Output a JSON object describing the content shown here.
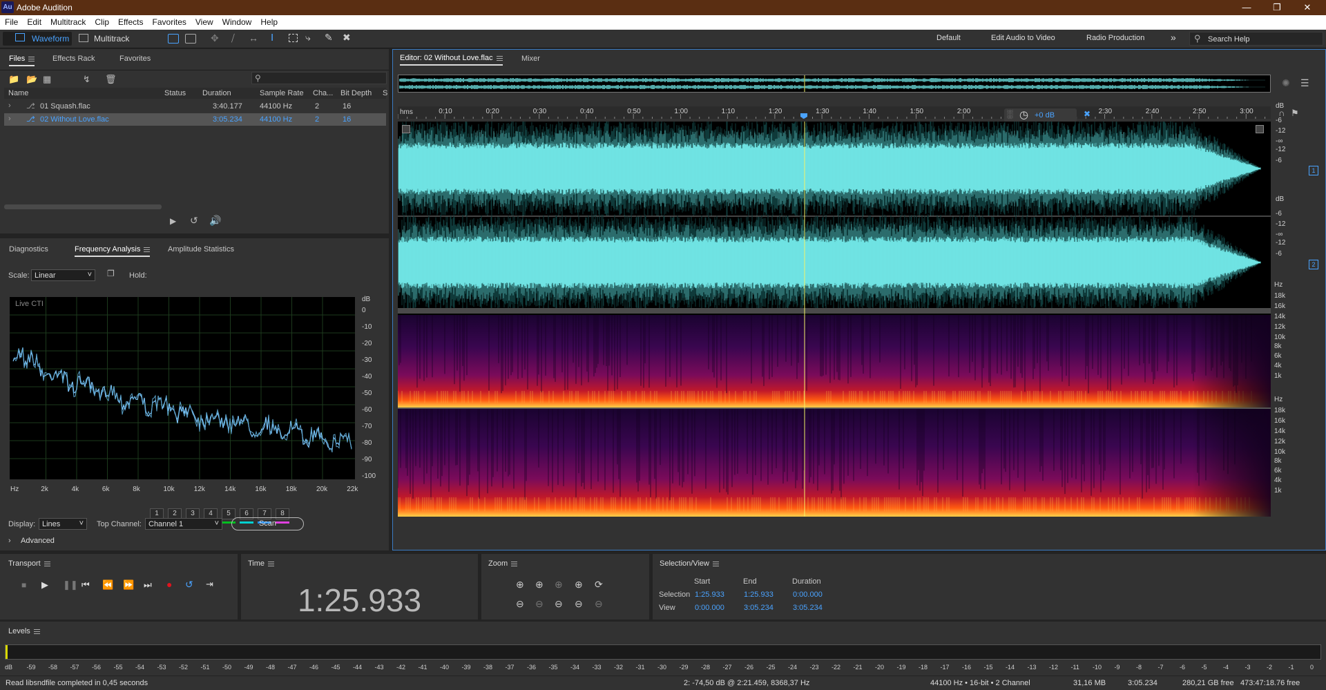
{
  "app": {
    "title": "Adobe Audition",
    "logo": "Au"
  },
  "menu": [
    "File",
    "Edit",
    "Multitrack",
    "Clip",
    "Effects",
    "Favorites",
    "View",
    "Window",
    "Help"
  ],
  "toolbar": {
    "waveform": "Waveform",
    "multitrack": "Multitrack",
    "workspaces": [
      "Default",
      "Edit Audio to Video",
      "Radio Production"
    ],
    "search_placeholder": "Search Help"
  },
  "files_panel": {
    "tabs": [
      "Files",
      "Effects Rack",
      "Favorites"
    ],
    "columns": [
      "Name",
      "Status",
      "Duration",
      "Sample Rate",
      "Cha...",
      "Bit Depth",
      "S"
    ],
    "rows": [
      {
        "name": "01 Squash.flac",
        "status": "",
        "duration": "3:40.177",
        "rate": "44100 Hz",
        "ch": "2",
        "bits": "16"
      },
      {
        "name": "02 Without Love.flac",
        "status": "",
        "duration": "3:05.234",
        "rate": "44100 Hz",
        "ch": "2",
        "bits": "16"
      }
    ]
  },
  "analysis": {
    "tabs": [
      "Diagnostics",
      "Frequency Analysis",
      "Amplitude Statistics"
    ],
    "scale_label": "Scale:",
    "scale_value": "Linear",
    "hold_label": "Hold:",
    "hold": [
      "1",
      "2",
      "3",
      "4",
      "5",
      "6",
      "7",
      "8"
    ],
    "hold_colors": [
      "#e0141e",
      "#ff8c00",
      "#f0e000",
      "#8ce000",
      "#00c020",
      "#00d0d0",
      "#1e90ff",
      "#e040e0"
    ],
    "live": "Live CTI",
    "db_unit": "dB",
    "db_ticks": [
      "0",
      "-10",
      "-20",
      "-30",
      "-40",
      "-50",
      "-60",
      "-70",
      "-80",
      "-90",
      "-100"
    ],
    "hz_ticks": [
      "Hz",
      "2k",
      "4k",
      "6k",
      "8k",
      "10k",
      "12k",
      "14k",
      "16k",
      "18k",
      "20k",
      "22k"
    ],
    "display_label": "Display:",
    "display_value": "Lines",
    "top_channel_label": "Top Channel:",
    "top_channel_value": "Channel 1",
    "scan": "Scan",
    "advanced": "Advanced"
  },
  "editor": {
    "tab": "Editor: 02 Without Love.flac",
    "mixer": "Mixer",
    "time_unit": "hms",
    "time_ticks": [
      "0:10",
      "0:20",
      "0:30",
      "0:40",
      "0:50",
      "1:00",
      "1:10",
      "1:20",
      "1:30",
      "1:40",
      "1:50",
      "2:00",
      "2:30",
      "2:40",
      "2:50",
      "3:00"
    ],
    "gain": "+0 dB",
    "db_ticks_ch": [
      "dB",
      "-6",
      "-12",
      "-∞",
      "-12",
      "-6"
    ],
    "ch_labels": [
      "1",
      "2"
    ],
    "hz_ticks_spec": [
      "Hz",
      "18k",
      "16k",
      "14k",
      "12k",
      "10k",
      "8k",
      "6k",
      "4k",
      "1k"
    ],
    "playhead_fraction": 0.4663
  },
  "transport": {
    "title": "Transport"
  },
  "time": {
    "title": "Time",
    "value": "1:25.933"
  },
  "zoom": {
    "title": "Zoom"
  },
  "selection": {
    "title": "Selection/View",
    "cols": [
      "Start",
      "End",
      "Duration"
    ],
    "selection_label": "Selection",
    "selection": [
      "1:25.933",
      "1:25.933",
      "0:00.000"
    ],
    "view_label": "View",
    "view": [
      "0:00.000",
      "3:05.234",
      "3:05.234"
    ]
  },
  "levels": {
    "title": "Levels",
    "ticks": [
      "dB",
      "-59",
      "-58",
      "-57",
      "-56",
      "-55",
      "-54",
      "-53",
      "-52",
      "-51",
      "-50",
      "-49",
      "-48",
      "-47",
      "-46",
      "-45",
      "-44",
      "-43",
      "-42",
      "-41",
      "-40",
      "-39",
      "-38",
      "-37",
      "-36",
      "-35",
      "-34",
      "-33",
      "-32",
      "-31",
      "-30",
      "-29",
      "-28",
      "-27",
      "-26",
      "-25",
      "-24",
      "-23",
      "-22",
      "-21",
      "-20",
      "-19",
      "-18",
      "-17",
      "-16",
      "-15",
      "-14",
      "-13",
      "-12",
      "-11",
      "-10",
      "-9",
      "-8",
      "-7",
      "-6",
      "-5",
      "-4",
      "-3",
      "-2",
      "-1",
      "0"
    ]
  },
  "status": {
    "left": "Read libsndfile completed in 0,45 seconds",
    "cursor": "2: -74,50 dB @ 2:21.459, 8368,37 Hz",
    "format": "44100 Hz • 16-bit • 2 Channel",
    "size": "31,16 MB",
    "duration": "3:05.234",
    "free": "280,21 GB free",
    "free_time": "473:47:18.76 free"
  },
  "colors": {
    "wave": "#6fe3e3",
    "accent": "#4aa3ff",
    "playhead": "#f3f36a"
  }
}
